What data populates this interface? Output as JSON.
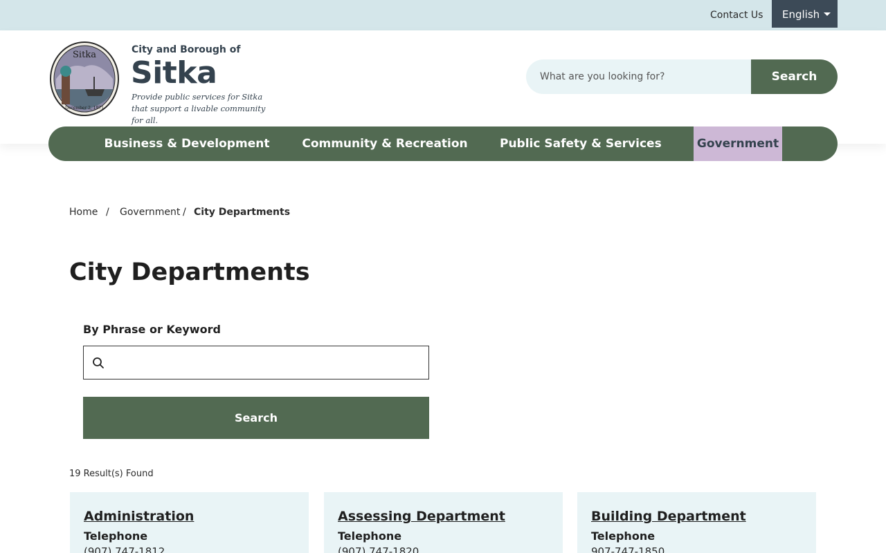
{
  "topbar": {
    "contact_label": "Contact Us",
    "language_label": "English"
  },
  "brand": {
    "small": "City and Borough of",
    "name": "Sitka",
    "tagline": "Provide public services for Sitka that support a livable community for all.",
    "seal_text": "Sitka",
    "seal_date": "December 2, 1971"
  },
  "header_search": {
    "placeholder": "What are you looking for?",
    "button_label": "Search"
  },
  "nav": {
    "items": [
      {
        "label": "Business & Development"
      },
      {
        "label": "Community & Recreation"
      },
      {
        "label": "Public Safety & Services"
      },
      {
        "label": "Government"
      }
    ],
    "active": "Government"
  },
  "breadcrumb": {
    "items": [
      "Home",
      "Government",
      "City Departments"
    ],
    "separator": "/"
  },
  "page": {
    "title": "City Departments"
  },
  "filter": {
    "label": "By Phrase or Keyword",
    "value": "",
    "button_label": "Search"
  },
  "results": {
    "count_text": "19 Result(s) Found",
    "cards": [
      {
        "title": "Administration",
        "subtitle": "Telephone",
        "phone": "(907) 747-1812"
      },
      {
        "title": "Assessing Department",
        "subtitle": "Telephone",
        "phone": "(907) 747-1820"
      },
      {
        "title": "Building Department",
        "subtitle": "Telephone",
        "phone": "907-747-1850"
      }
    ]
  },
  "colors": {
    "primary_green": "#526a52",
    "topbar_bg": "#d4e6ea",
    "nav_active": "#cdb8d6",
    "brand_text": "#34424e",
    "card_bg": "#e9f4f6"
  }
}
